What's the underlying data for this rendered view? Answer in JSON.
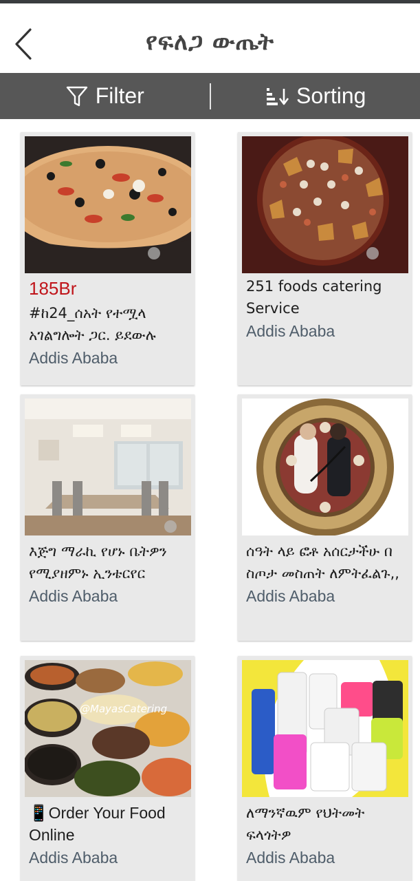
{
  "header": {
    "title": "የፍለጋ ውጤት"
  },
  "toolbar": {
    "filter_label": "Filter",
    "sorting_label": "Sorting"
  },
  "listings": [
    {
      "price": "185Br",
      "title": "#ከ24_ሰአት የተሟላ አገልግሎት ጋር. ይደውሉ",
      "location": "Addis Ababa",
      "image": "pizza"
    },
    {
      "price": "",
      "title": "251 foods catering Service",
      "location": "Addis Ababa",
      "image": "catering-platter"
    },
    {
      "price": "",
      "title": " እጅግ ማራኪ የሆኑ ቤትዎን የሚያዘምኑ ኢንቴርየር",
      "location": "Addis Ababa",
      "image": "interior-dining"
    },
    {
      "price": "",
      "title": "ሰዓት ላይ ፎቶ አሰርታችሁ በ ስጦታ መስጠት ለምትፈልጉ,,",
      "location": "Addis Ababa",
      "image": "photo-clock"
    },
    {
      "price": "",
      "title": "📱Order Your Food Online",
      "location": "Addis Ababa",
      "image": "food-buffet",
      "watermark": "@MayasCatering"
    },
    {
      "price": "",
      "title": "ለማንኛዉም የህትመት ፍላጎትዎ",
      "location": "Addis Ababa",
      "image": "printed-uniforms"
    }
  ]
}
